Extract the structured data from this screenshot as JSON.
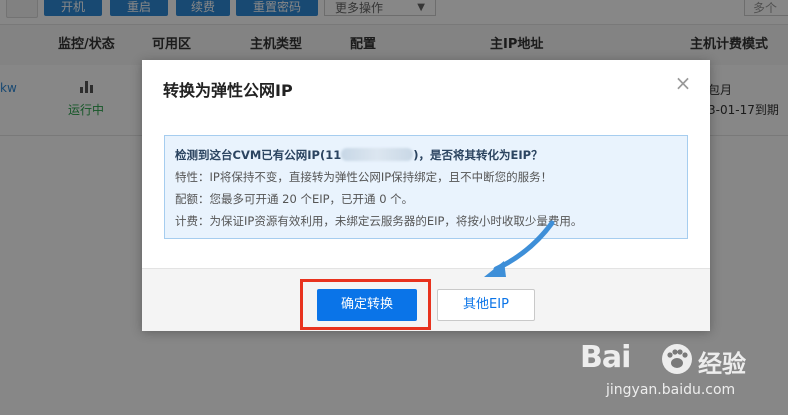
{
  "background": {
    "toolbar": {
      "buttons": [
        "开机",
        "重启",
        "续费",
        "重置密码"
      ],
      "more_actions": "更多操作",
      "search_placeholder": "多个"
    },
    "table": {
      "columns": [
        "监控/状态",
        "可用区",
        "主机类型",
        "配置",
        "主IP地址",
        "主机计费模式"
      ],
      "row": {
        "id_fragment": "kw",
        "status": "运行中",
        "billing_mode": "包月",
        "expiry": "3-01-17到期"
      }
    }
  },
  "modal": {
    "title": "转换为弹性公网IP",
    "close_icon": "close-icon",
    "info": {
      "question_prefix": "检测到这台CVM已有公网IP(11",
      "question_suffix": ")，是否将其转化为EIP？",
      "feature": "特性：IP将保持不变，直接转为弹性公网IP保持绑定，且不中断您的服务！",
      "quota": "配额：您最多可开通 20 个EIP，已开通 0 个。",
      "billing": "计费：为保证IP资源有效利用，未绑定云服务器的EIP，将按小时收取少量费用。"
    },
    "confirm_button": "确定转换",
    "other_button": "其他EIP"
  },
  "watermark": {
    "logo": "Bai",
    "brand_cn": "经验",
    "url": "jingyan.baidu.com"
  },
  "colors": {
    "primary": "#0a74e8",
    "annotation_red": "#e8321e",
    "annotation_arrow": "#3e8fd8",
    "info_bg": "#e9f3fd",
    "status_green": "#2aa44c"
  }
}
